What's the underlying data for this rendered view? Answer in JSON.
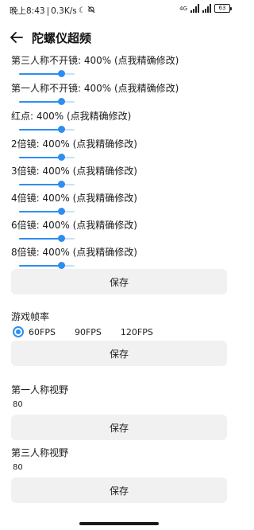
{
  "status": {
    "time": "晚上8:43",
    "speed": "0.3K/s",
    "battery": "63",
    "network": "4G"
  },
  "header": {
    "title": "陀螺仪超频"
  },
  "settings": [
    {
      "label": "第三人称不开镜: 400% (点我精确修改)",
      "level": 0.75
    },
    {
      "label": "第一人称不开镜: 400% (点我精确修改)",
      "level": 0.75
    },
    {
      "label": "红点: 400% (点我精确修改)",
      "level": 0.75
    },
    {
      "label": "2倍镜: 400% (点我精确修改)",
      "level": 0.75
    },
    {
      "label": "3倍镜: 400% (点我精确修改)",
      "level": 0.75
    },
    {
      "label": "4倍镜: 400% (点我精确修改)",
      "level": 0.75
    },
    {
      "label": "6倍镜: 400% (点我精确修改)",
      "level": 0.75
    },
    {
      "label": "8倍镜: 400% (点我精确修改)",
      "level": 0.75
    }
  ],
  "save_label": "保存",
  "fps": {
    "label": "游戏帧率",
    "options": [
      "60FPS",
      "90FPS",
      "120FPS"
    ],
    "selected": "60FPS"
  },
  "fov_first": {
    "label": "第一人称视野",
    "value": "80"
  },
  "fov_third": {
    "label": "第三人称视野",
    "value": "80"
  },
  "colors": {
    "accent": "#2e8ef0",
    "track": "#c9dff7",
    "button_bg": "#f1f1f1"
  }
}
